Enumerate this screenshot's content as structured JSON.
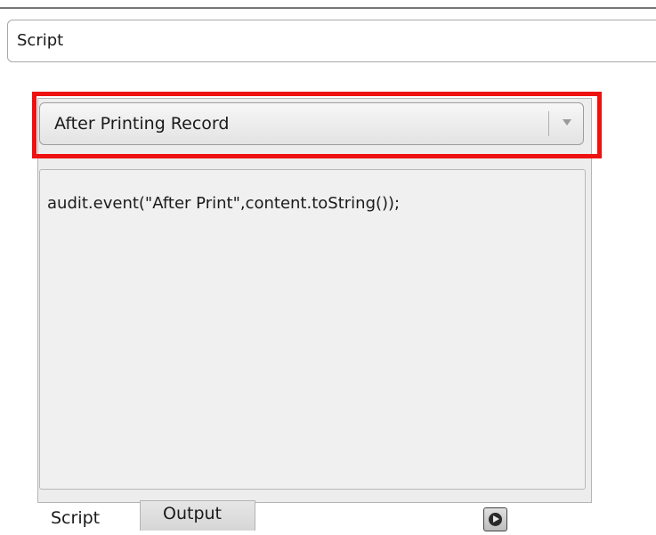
{
  "section": {
    "title": "Script"
  },
  "event_select": {
    "selected": "After Printing Record",
    "icon": "chevron-down-icon"
  },
  "editor": {
    "code": "audit.event(\"After Print\",content.toString());"
  },
  "tabs": [
    {
      "label": "Script",
      "active": true
    },
    {
      "label": "Output",
      "active": false
    }
  ],
  "run_button": {
    "icon": "play-circle-icon"
  },
  "colors": {
    "highlight": "#ee1111",
    "panel_bg": "#ededed",
    "editor_bg": "#f0f0f0"
  }
}
